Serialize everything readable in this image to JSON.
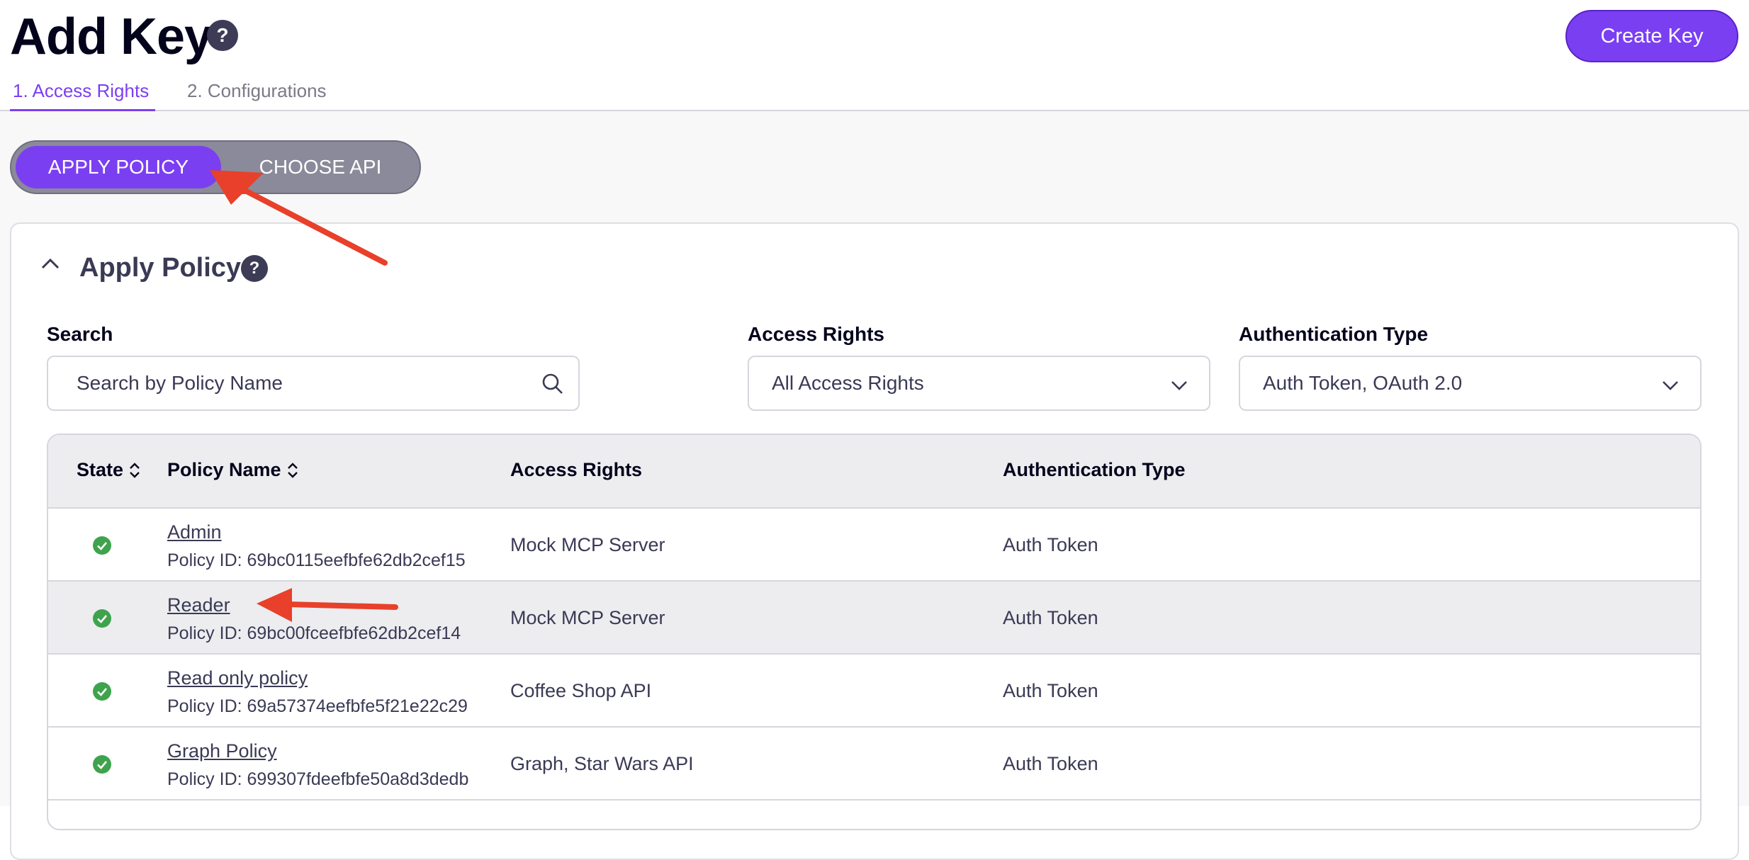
{
  "header": {
    "title": "Add Key",
    "create_button": "Create Key",
    "tabs": [
      {
        "label": "1. Access Rights",
        "active": true
      },
      {
        "label": "2. Configurations",
        "active": false
      }
    ]
  },
  "toggle": {
    "apply_policy": "APPLY POLICY",
    "choose_api": "CHOOSE API"
  },
  "panel": {
    "title": "Apply Policy",
    "search": {
      "label": "Search",
      "placeholder": "Search by Policy Name"
    },
    "access_rights_filter": {
      "label": "Access Rights",
      "value": "All Access Rights"
    },
    "auth_type_filter": {
      "label": "Authentication Type",
      "value": "Auth Token, OAuth 2.0"
    }
  },
  "table": {
    "columns": [
      "State",
      "Policy Name",
      "Access Rights",
      "Authentication Type"
    ],
    "rows": [
      {
        "name": "Admin",
        "policy_id": "Policy ID: 69bc0115eefbfe62db2cef15",
        "access_rights": "Mock MCP Server",
        "auth_type": "Auth Token"
      },
      {
        "name": "Reader",
        "policy_id": "Policy ID: 69bc00fceefbfe62db2cef14",
        "access_rights": "Mock MCP Server",
        "auth_type": "Auth Token"
      },
      {
        "name": "Read only policy",
        "policy_id": "Policy ID: 69a57374eefbfe5f21e22c29",
        "access_rights": "Coffee Shop API",
        "auth_type": "Auth Token"
      },
      {
        "name": "Graph Policy",
        "policy_id": "Policy ID: 699307fdeefbfe50a8d3dedb",
        "access_rights": "Graph, Star Wars API",
        "auth_type": "Auth Token"
      }
    ]
  },
  "colors": {
    "accent": "#7b3ff2",
    "annotation_arrow": "#e8402a",
    "state_ok": "#3fa34d"
  },
  "icons": {
    "help": "question-mark-icon",
    "collapse": "chevron-up-icon",
    "search": "search-icon",
    "select": "chevron-down-icon",
    "sort": "sort-icon",
    "state": "check-circle-icon"
  }
}
